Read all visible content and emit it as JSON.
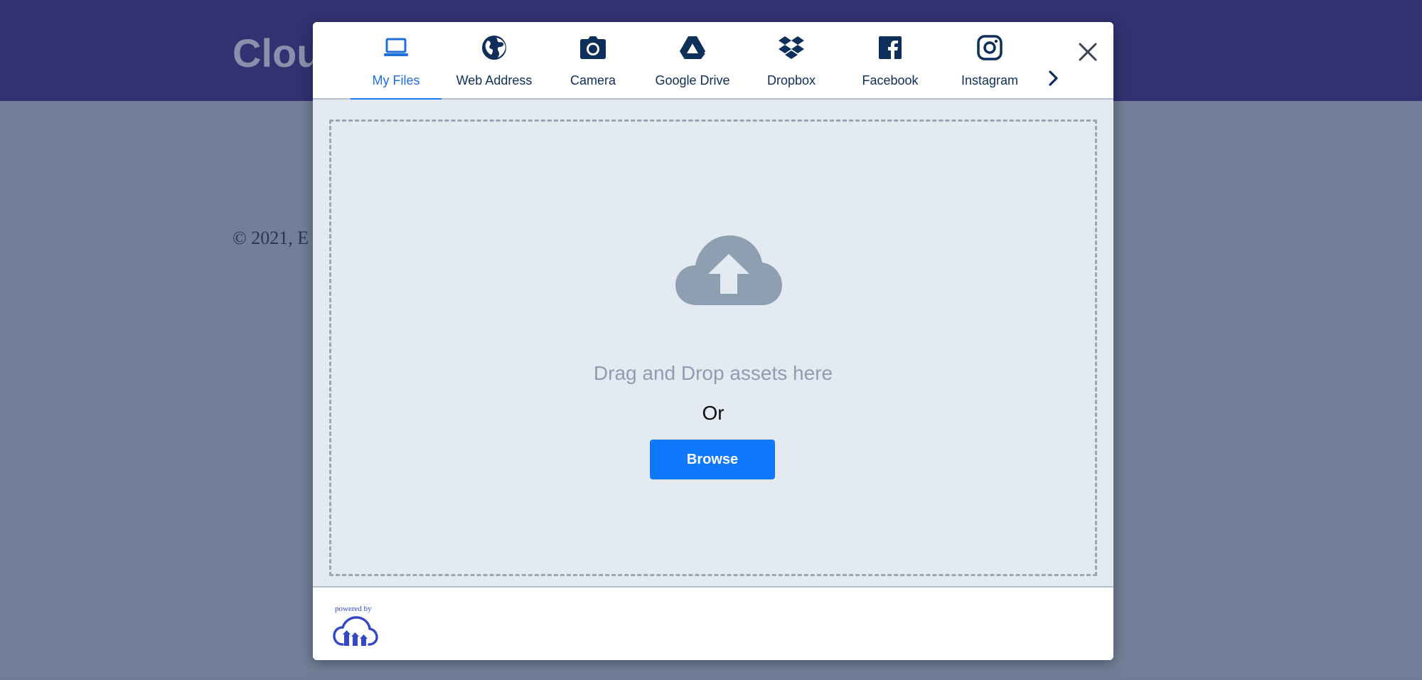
{
  "background": {
    "title": "Clou",
    "copyright": "© 2021, E"
  },
  "modal": {
    "tabs": [
      {
        "label": "My Files",
        "icon": "laptop-icon",
        "active": true
      },
      {
        "label": "Web Address",
        "icon": "globe-icon",
        "active": false
      },
      {
        "label": "Camera",
        "icon": "camera-icon",
        "active": false
      },
      {
        "label": "Google Drive",
        "icon": "google-drive-icon",
        "active": false
      },
      {
        "label": "Dropbox",
        "icon": "dropbox-icon",
        "active": false
      },
      {
        "label": "Facebook",
        "icon": "facebook-icon",
        "active": false
      },
      {
        "label": "Instagram",
        "icon": "instagram-icon",
        "active": false
      }
    ],
    "dropzone": {
      "drag_text": "Drag and Drop assets here",
      "or_text": "Or",
      "browse_label": "Browse"
    },
    "footer": {
      "powered_by": "powered by"
    }
  },
  "colors": {
    "accent": "#1a7af8",
    "browse_button": "#0f78fd",
    "tab_text": "#0e2f5a",
    "header_bg": "#323171",
    "overlay_bg": "#717f98",
    "dropzone_bg": "#e3eaf1",
    "brand": "#3448c5"
  }
}
